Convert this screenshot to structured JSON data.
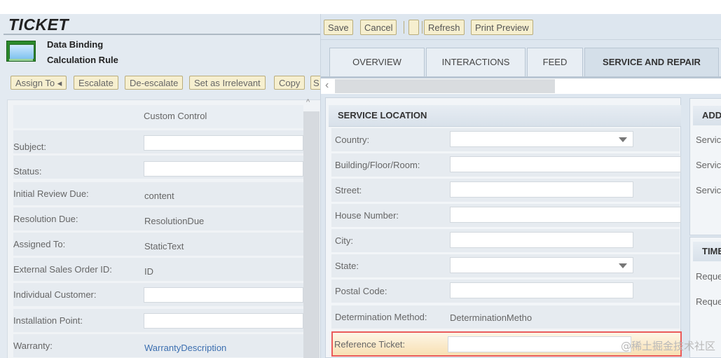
{
  "header": {
    "title": "TICKET",
    "subtitle1": "Data Binding",
    "subtitle2": "Calculation Rule"
  },
  "left_toolbar": {
    "assign": "Assign To ◂",
    "escalate": "Escalate",
    "deescalate": "De-escalate",
    "irrelevant": "Set as Irrelevant",
    "copy": "Copy",
    "cut": "S"
  },
  "left_form": {
    "custom_control": "Custom Control",
    "rows": [
      {
        "label": "Subject:",
        "value": ""
      },
      {
        "label": "Status:",
        "value": ""
      },
      {
        "label": "Initial Review Due:",
        "value": "content"
      },
      {
        "label": "Resolution Due:",
        "value": "ResolutionDue"
      },
      {
        "label": "Assigned To:",
        "value": "StaticText"
      },
      {
        "label": "External Sales Order ID:",
        "value": "ID"
      },
      {
        "label": "Individual Customer:",
        "value": ""
      },
      {
        "label": "Installation Point:",
        "value": ""
      },
      {
        "label": "Warranty:",
        "value": "WarrantyDescription"
      }
    ]
  },
  "toolbar": {
    "save": "Save",
    "cancel": "Cancel",
    "blank": "",
    "refresh": "Refresh",
    "print_preview": "Print Preview"
  },
  "tabs": [
    "OVERVIEW",
    "INTERACTIONS",
    "FEED",
    "SERVICE AND REPAIR"
  ],
  "service_location": {
    "title": "SERVICE LOCATION",
    "rows": [
      {
        "label": "Country:",
        "value": ""
      },
      {
        "label": "Building/Floor/Room:",
        "value": ""
      },
      {
        "label": "Street:",
        "value": ""
      },
      {
        "label": "House Number:",
        "value": ""
      },
      {
        "label": "City:",
        "value": ""
      },
      {
        "label": "State:",
        "value": ""
      },
      {
        "label": "Postal Code:",
        "value": ""
      },
      {
        "label": "Determination Method:",
        "value": "DeterminationMetho"
      },
      {
        "label": "Reference Ticket:",
        "value": ""
      }
    ]
  },
  "add_panel": {
    "title": "ADD",
    "items": [
      "Servic",
      "Servic",
      "Servic"
    ]
  },
  "time_panel": {
    "title": "TIME",
    "items": [
      "Reque",
      "Reque"
    ]
  },
  "watermark": "@稀土掘金技术社区"
}
